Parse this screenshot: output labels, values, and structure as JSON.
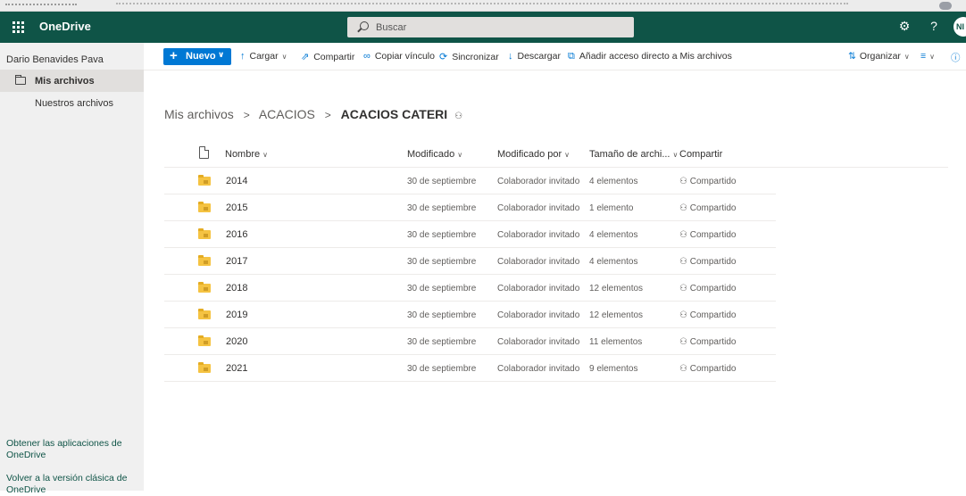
{
  "topbar": {
    "app_name": "OneDrive",
    "search_placeholder": "Buscar",
    "settings_glyph": "⚙",
    "help_glyph": "?",
    "avatar_initials": "NI"
  },
  "sidebar": {
    "user_name": "Dario Benavides Pava",
    "items": [
      {
        "label": "Mis archivos",
        "active": true
      },
      {
        "label": "Nuestros archivos",
        "active": false
      }
    ],
    "links": [
      "Obtener las aplicaciones de OneDrive",
      "Volver a la versión clásica de OneDrive"
    ]
  },
  "toolbar": {
    "new_label": "Nuevo",
    "commands": [
      {
        "label": "Cargar",
        "icon": "upload-icon",
        "dropdown": true
      },
      {
        "label": "Compartir",
        "icon": "share-icon",
        "dropdown": false
      },
      {
        "label": "Copiar vínculo",
        "icon": "link-icon",
        "dropdown": false
      },
      {
        "label": "Sincronizar",
        "icon": "sync-icon",
        "dropdown": false
      },
      {
        "label": "Descargar",
        "icon": "download-icon",
        "dropdown": false
      },
      {
        "label": "Añadir acceso directo a Mis archivos",
        "icon": "shortcut-icon",
        "dropdown": false
      }
    ],
    "sort_label": "Organizar"
  },
  "breadcrumb": {
    "items": [
      "Mis archivos",
      "ACACIOS"
    ],
    "current": "ACACIOS CATERI"
  },
  "table": {
    "columns": {
      "name": "Nombre",
      "modified": "Modificado",
      "modified_by": "Modificado por",
      "size": "Tamaño de archi...",
      "sharing": "Compartir"
    },
    "rows": [
      {
        "name": "2014",
        "modified": "30 de septiembre",
        "modified_by": "Colaborador invitado",
        "size": "4 elementos",
        "sharing": "Compartido"
      },
      {
        "name": "2015",
        "modified": "30 de septiembre",
        "modified_by": "Colaborador invitado",
        "size": "1 elemento",
        "sharing": "Compartido"
      },
      {
        "name": "2016",
        "modified": "30 de septiembre",
        "modified_by": "Colaborador invitado",
        "size": "4 elementos",
        "sharing": "Compartido"
      },
      {
        "name": "2017",
        "modified": "30 de septiembre",
        "modified_by": "Colaborador invitado",
        "size": "4 elementos",
        "sharing": "Compartido"
      },
      {
        "name": "2018",
        "modified": "30 de septiembre",
        "modified_by": "Colaborador invitado",
        "size": "12 elementos",
        "sharing": "Compartido"
      },
      {
        "name": "2019",
        "modified": "30 de septiembre",
        "modified_by": "Colaborador invitado",
        "size": "12 elementos",
        "sharing": "Compartido"
      },
      {
        "name": "2020",
        "modified": "30 de septiembre",
        "modified_by": "Colaborador invitado",
        "size": "11 elementos",
        "sharing": "Compartido"
      },
      {
        "name": "2021",
        "modified": "30 de septiembre",
        "modified_by": "Colaborador invitado",
        "size": "9 elementos",
        "sharing": "Compartido"
      }
    ]
  },
  "colors": {
    "header": "#0f5447",
    "accent": "#0078d4",
    "folder": "#f5c342"
  }
}
